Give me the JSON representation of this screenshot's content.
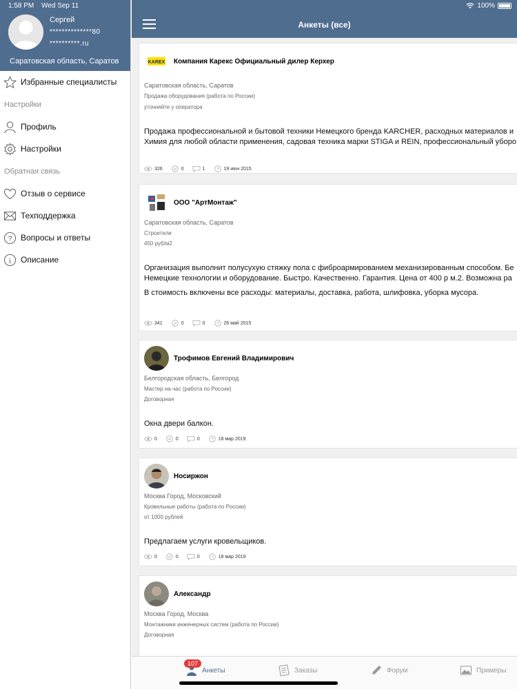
{
  "status_bar": {
    "time": "1:58 PM",
    "date": "Wed Sep 11",
    "battery": "100%"
  },
  "sidebar": {
    "user": {
      "name": "Сергей",
      "phone": "**************80",
      "email": "**********.ru",
      "location": "Саратовская область, Саратов"
    },
    "items": [
      {
        "type": "item",
        "label": "Избранные специалисты",
        "icon": "star-icon"
      },
      {
        "type": "section",
        "label": "Настройки"
      },
      {
        "type": "item",
        "label": "Профиль",
        "icon": "person-icon"
      },
      {
        "type": "item",
        "label": "Настройки",
        "icon": "gear-icon"
      },
      {
        "type": "section",
        "label": "Обратная связь"
      },
      {
        "type": "item",
        "label": "Отзыв о сервисе",
        "icon": "heart-icon"
      },
      {
        "type": "item",
        "label": "Техподдержка",
        "icon": "envelope-icon"
      },
      {
        "type": "item",
        "label": "Вопросы и ответы",
        "icon": "question-icon"
      },
      {
        "type": "item",
        "label": "Описание",
        "icon": "info-icon"
      }
    ]
  },
  "header": {
    "title": "Анкеты (все)"
  },
  "cards": [
    {
      "title": "Компания Карекс Официальный дилер Керхер",
      "location": "Саратовская область, Саратов",
      "category": "Продажа оборудования (работа по России)",
      "price": "уточняйте у оператора",
      "description": [
        "Продажа профессиональной и бытовой техники Немецкого бренда KARCHER, расходных материалов и",
        "Химия для любой области применения, садовая техника марки STIGA и REIN, профессиональный уборо"
      ],
      "views": "326",
      "checks": "0",
      "comments": "1",
      "date": "19 июн 2015"
    },
    {
      "title": "ООО \"АртМонтаж\"",
      "location": "Саратовская область, Саратов",
      "category": "Строители",
      "price": "450 руб/м2",
      "description": [
        "Организация выполнит полусухую стяжку пола с фиброармированием механизированным способом. Бе",
        "Немецкие технологии и оборудование. Быстро. Качественно. Гарантия. Цена от 400 р м.2. Возможна ра",
        "В стоимость включены все расходы: материалы, доставка, работа, шлифовка, уборка мусора."
      ],
      "views": "341",
      "checks": "0",
      "comments": "0",
      "date": "26 май 2015"
    },
    {
      "title": "Трофимов Евгений Владимирович",
      "location": "Белгородская область, Белгород",
      "category": "Мастер на час (работа по России)",
      "price": "Договорная",
      "description": [
        "Окна двери балкон."
      ],
      "views": "0",
      "checks": "0",
      "comments": "0",
      "date": "18 мар 2019"
    },
    {
      "title": "Носиржон",
      "location": "Москва Город, Московский",
      "category": "Кровельные работы (работа по России)",
      "price": "от 1000 рублей",
      "description": [
        "Предлагаем услуги кровельщиков."
      ],
      "views": "0",
      "checks": "0",
      "comments": "0",
      "date": "18 мар 2019"
    },
    {
      "title": "Александр",
      "location": "Москва Город, Москва",
      "category": "Монтажники инженерных систем (работа по России)",
      "price": "Договорная",
      "description": [],
      "views": "",
      "checks": "",
      "comments": "",
      "date": ""
    }
  ],
  "tabbar": {
    "tabs": [
      {
        "label": "Анкеты",
        "icon": "person-badge-icon",
        "active": true
      },
      {
        "label": "Заказы",
        "icon": "notepad-icon",
        "active": false
      },
      {
        "label": "Форум",
        "icon": "pen-icon",
        "active": false
      },
      {
        "label": "Примеры",
        "icon": "picture-icon",
        "active": false
      }
    ],
    "badge": "107"
  },
  "colors": {
    "header": "#4f6d8f",
    "badge": "#e23b3b"
  }
}
